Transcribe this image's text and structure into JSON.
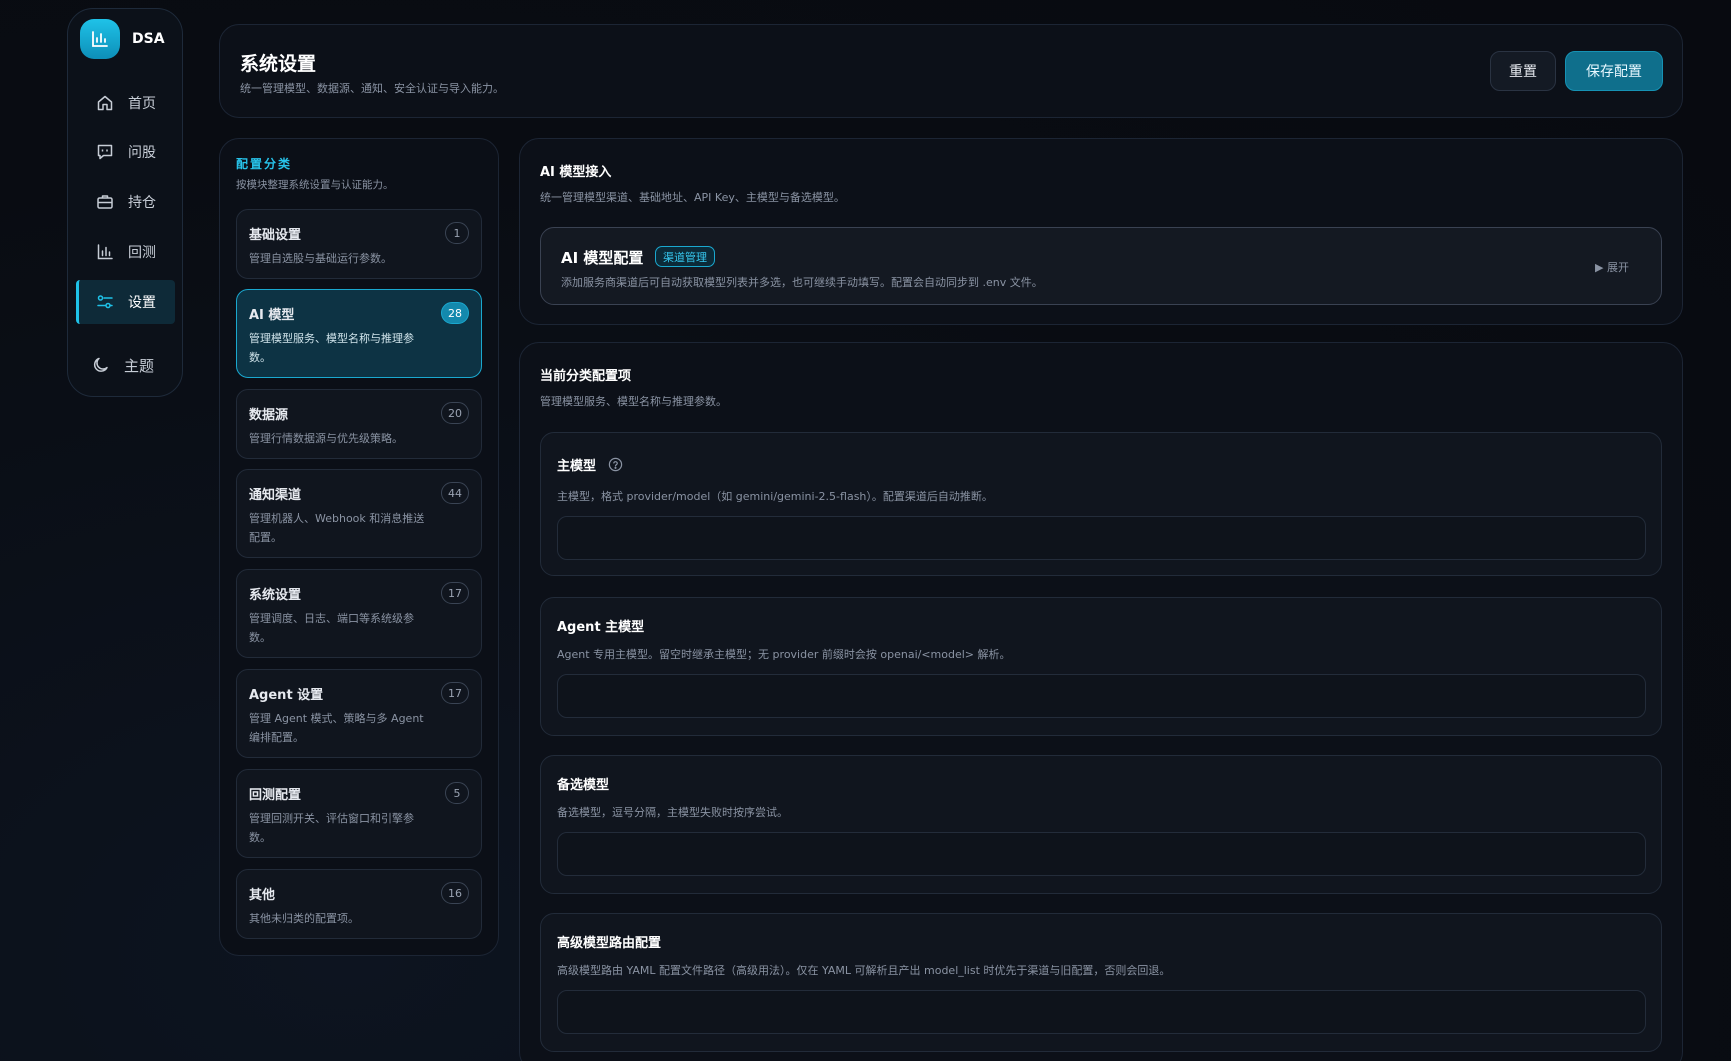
{
  "brand": {
    "name": "DSA",
    "logo_icon": "bar-chart-icon",
    "accent": "#1fc2e8"
  },
  "nav": [
    {
      "label": "首页",
      "icon": "home-icon"
    },
    {
      "label": "问股",
      "icon": "chat-icon"
    },
    {
      "label": "持仓",
      "icon": "briefcase-icon"
    },
    {
      "label": "回测",
      "icon": "bar-chart-icon"
    },
    {
      "label": "设置",
      "icon": "sliders-icon",
      "active": true
    },
    {
      "label": "主题",
      "icon": "moon-icon"
    }
  ],
  "header": {
    "title": "系统设置",
    "subtitle": "统一管理模型、数据源、通知、安全认证与导入能力。",
    "reset_label": "重置",
    "save_label": "保存配置"
  },
  "categories": {
    "title": "配置分类",
    "subtitle": "按模块整理系统设置与认证能力。",
    "items": [
      {
        "name": "基础设置",
        "desc": "管理自选股与基础运行参数。",
        "count": "1"
      },
      {
        "name": "AI 模型",
        "desc": "管理模型服务、模型名称与推理参数。",
        "count": "28",
        "active": true
      },
      {
        "name": "数据源",
        "desc": "管理行情数据源与优先级策略。",
        "count": "20"
      },
      {
        "name": "通知渠道",
        "desc": "管理机器人、Webhook 和消息推送配置。",
        "count": "44"
      },
      {
        "name": "系统设置",
        "desc": "管理调度、日志、端口等系统级参数。",
        "count": "17"
      },
      {
        "name": "Agent 设置",
        "desc": "管理 Agent 模式、策略与多 Agent 编排配置。",
        "count": "17"
      },
      {
        "name": "回测配置",
        "desc": "管理回测开关、评估窗口和引擎参数。",
        "count": "5"
      },
      {
        "name": "其他",
        "desc": "其他未归类的配置项。",
        "count": "16"
      }
    ]
  },
  "ai_access": {
    "title": "AI 模型接入",
    "subtitle": "统一管理模型渠道、基础地址、API Key、主模型与备选模型。",
    "box_title": "AI 模型配置",
    "box_tag": "渠道管理",
    "box_subtitle": "添加服务商渠道后可自动获取模型列表并多选，也可继续手动填写。配置会自动同步到 .env 文件。",
    "expand_label": "▶ 展开"
  },
  "current": {
    "title": "当前分类配置项",
    "subtitle": "管理模型服务、模型名称与推理参数。",
    "fields": [
      {
        "label": "主模型",
        "desc": "主模型，格式 provider/model（如 gemini/gemini-2.5-flash）。配置渠道后自动推断。",
        "value": "",
        "help_icon": "help-circle-icon"
      },
      {
        "label": "Agent 主模型",
        "desc": "Agent 专用主模型。留空时继承主模型；无 provider 前缀时会按 openai/<model> 解析。",
        "value": ""
      },
      {
        "label": "备选模型",
        "desc": "备选模型，逗号分隔，主模型失败时按序尝试。",
        "value": ""
      },
      {
        "label": "高级模型路由配置",
        "desc": "高级模型路由 YAML 配置文件路径（高级用法）。仅在 YAML 可解析且产出 model_list 时优先于渠道与旧配置，否则会回退。",
        "value": ""
      }
    ]
  }
}
